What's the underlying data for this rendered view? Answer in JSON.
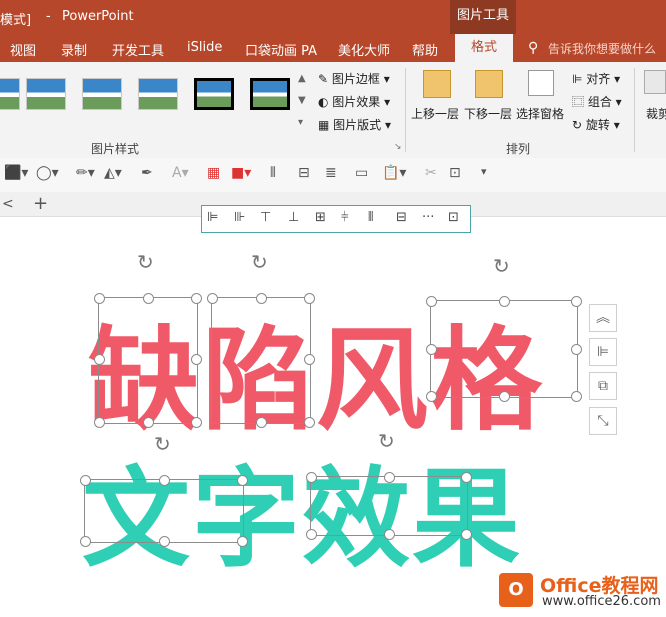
{
  "titlebar": {
    "mode_fragment": "模式]",
    "separator": "-",
    "app_name": "PowerPoint",
    "context_header": "图片工具"
  },
  "tabs": [
    "视图",
    "录制",
    "开发工具",
    "iSlide",
    "口袋动画 PA",
    "美化大师",
    "帮助"
  ],
  "active_tab": "格式",
  "search": {
    "placeholder": "告诉我你想要做什么"
  },
  "ribbon": {
    "picture_border": "图片边框",
    "picture_effects": "图片效果",
    "picture_layout": "图片版式",
    "bring_forward": "上移一层",
    "send_backward": "下移一层",
    "selection_pane": "选择窗格",
    "align": "对齐",
    "group": "组合",
    "rotate": "旋转",
    "crop_partial": "裁剪",
    "group_picture_styles": "图片样式",
    "group_arrange": "排列"
  },
  "tabstrip": {
    "back": "<",
    "add": "+"
  },
  "canvas": {
    "line1": "缺陷风格",
    "line2": "文字效果"
  },
  "watermark": {
    "logo_glyph": "O",
    "title": "Office教程网",
    "url": "www.office26.com"
  },
  "colors": {
    "titlebar": "#b7472a",
    "text_red": "#f05a68",
    "text_teal": "#2ecfb4",
    "watermark": "#e8611b"
  }
}
